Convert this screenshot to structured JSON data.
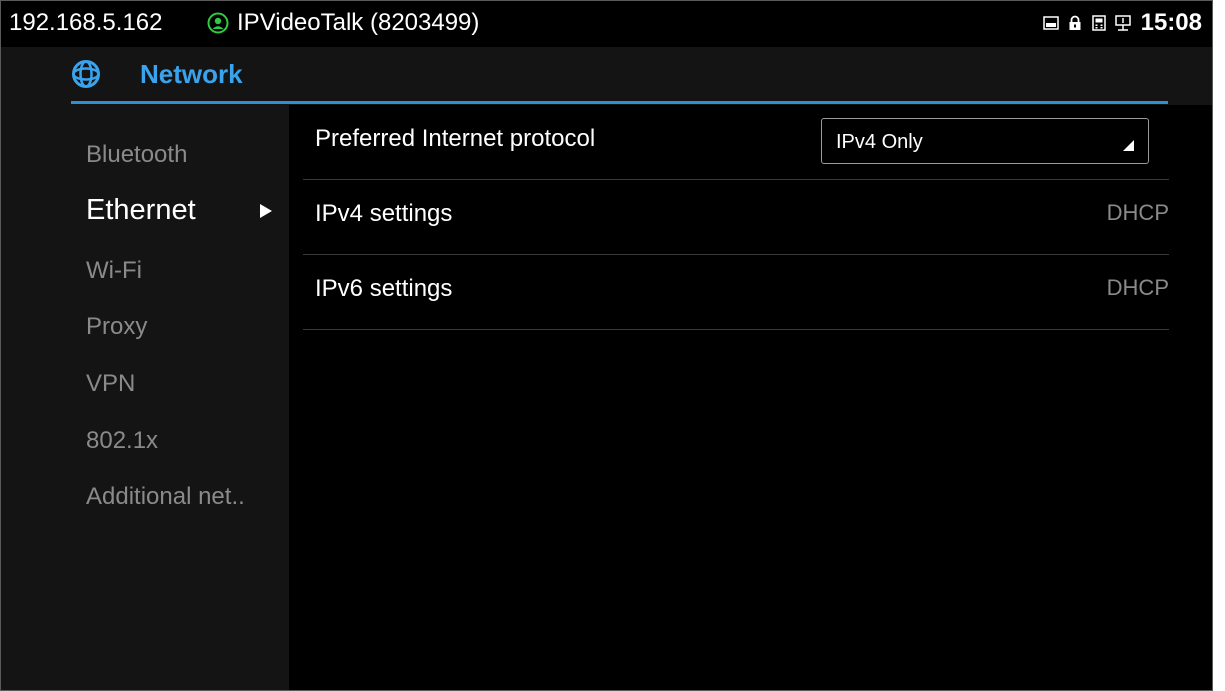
{
  "status_bar": {
    "ip": "192.168.5.162",
    "account": "IPVideoTalk (8203499)",
    "time": "15:08",
    "icons": [
      "picture-icon",
      "lock-icon",
      "sim-icon",
      "network-icon"
    ]
  },
  "header": {
    "title": "Network",
    "accent_color": "#3aa3ee"
  },
  "sidebar": {
    "items": [
      {
        "label": "Bluetooth"
      },
      {
        "label": "Ethernet",
        "active": true
      },
      {
        "label": "Wi-Fi"
      },
      {
        "label": "Proxy"
      },
      {
        "label": "VPN"
      },
      {
        "label": "802.1x"
      },
      {
        "label": "Additional net.."
      }
    ]
  },
  "settings": {
    "protocol": {
      "label": "Preferred Internet protocol",
      "value": "IPv4 Only"
    },
    "ipv4": {
      "label": "IPv4 settings",
      "value": "DHCP"
    },
    "ipv6": {
      "label": "IPv6 settings",
      "value": "DHCP"
    }
  }
}
